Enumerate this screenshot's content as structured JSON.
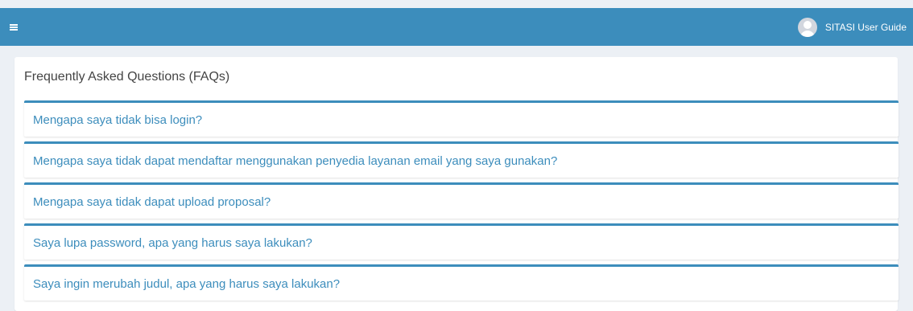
{
  "colors": {
    "accent": "#3c8dbc",
    "background": "#ecf0f5",
    "card": "#ffffff",
    "title_text": "#444444"
  },
  "header": {
    "menu_icon": "hamburger-icon",
    "avatar_icon": "user-avatar-icon",
    "user_label": "SITASI User Guide"
  },
  "faq": {
    "title": "Frequently Asked Questions (FAQs)",
    "items": [
      {
        "question": "Mengapa saya tidak bisa login?"
      },
      {
        "question": "Mengapa saya tidak dapat mendaftar menggunakan penyedia layanan email yang saya gunakan?"
      },
      {
        "question": "Mengapa saya tidak dapat upload proposal?"
      },
      {
        "question": "Saya lupa password, apa yang harus saya lakukan?"
      },
      {
        "question": "Saya ingin merubah judul, apa yang harus saya lakukan?"
      }
    ]
  }
}
